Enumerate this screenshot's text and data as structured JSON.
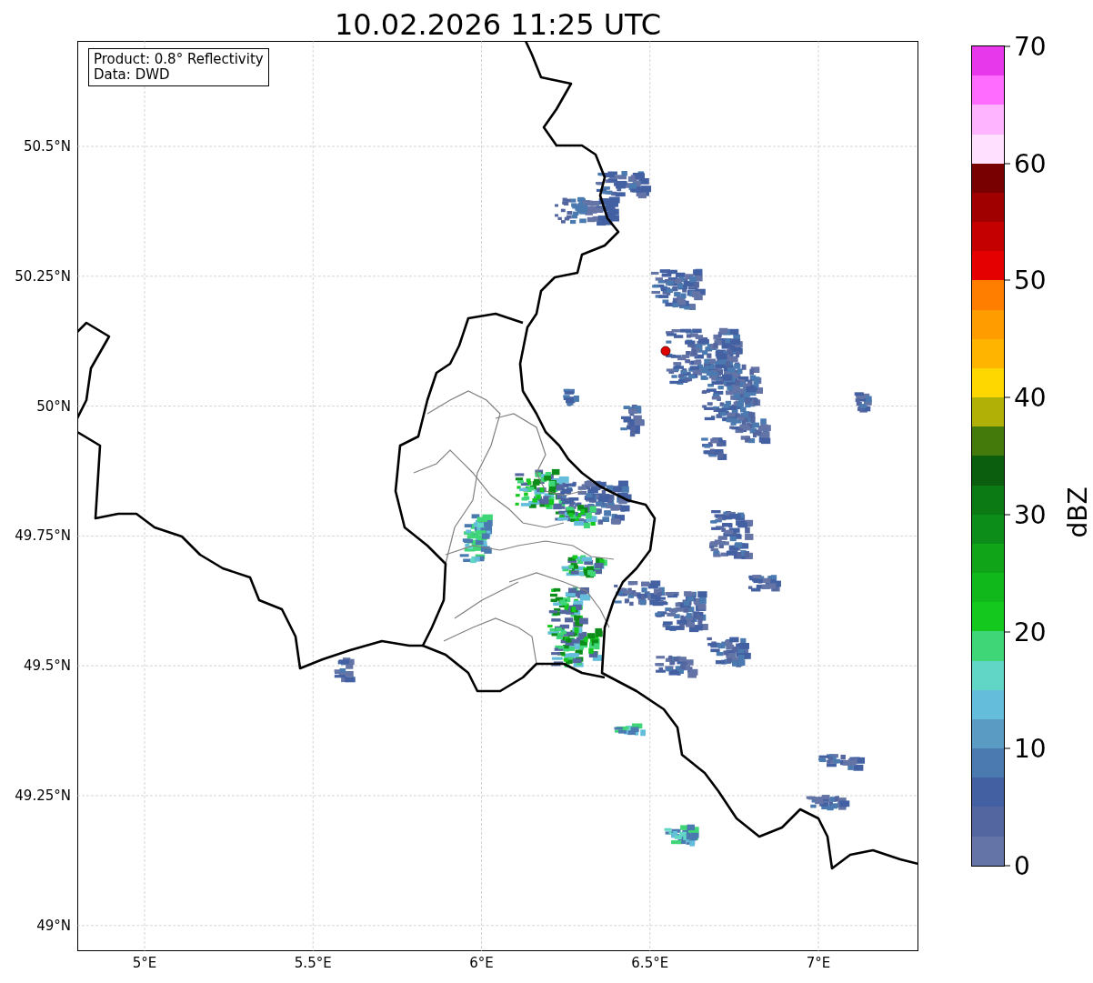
{
  "title": "10.02.2026 11:25 UTC",
  "legend": {
    "lines": [
      "Product: 0.8° Reflectivity",
      "Data: DWD"
    ]
  },
  "map": {
    "y_ticks": [
      "50.5°N",
      "50.25°N",
      "50°N",
      "49.75°N",
      "49.5°N",
      "49.25°N",
      "49°N"
    ],
    "x_ticks": [
      "5°E",
      "5.5°E",
      "6°E",
      "6.5°E",
      "7°E"
    ]
  },
  "colorbar": {
    "label": "dBZ",
    "ticks": [
      "70",
      "60",
      "50",
      "40",
      "30",
      "20",
      "10",
      "0"
    ],
    "segments": [
      {
        "color": "#e838ec"
      },
      {
        "color": "#ff6cff"
      },
      {
        "color": "#ffb4ff"
      },
      {
        "color": "#ffe0ff"
      },
      {
        "color": "#780000"
      },
      {
        "color": "#a00000"
      },
      {
        "color": "#c40000"
      },
      {
        "color": "#e40000"
      },
      {
        "color": "#ff7e00"
      },
      {
        "color": "#ff9c00"
      },
      {
        "color": "#ffb400"
      },
      {
        "color": "#ffd700"
      },
      {
        "color": "#b0b006"
      },
      {
        "color": "#447a0c"
      },
      {
        "color": "#0a5e0e"
      },
      {
        "color": "#0c7a14"
      },
      {
        "color": "#0c8c18"
      },
      {
        "color": "#10a418"
      },
      {
        "color": "#10b81c"
      },
      {
        "color": "#14c81e"
      },
      {
        "color": "#3ed676"
      },
      {
        "color": "#62d6c6"
      },
      {
        "color": "#64bedb"
      },
      {
        "color": "#5a9bc4"
      },
      {
        "color": "#4a7ab0"
      },
      {
        "color": "#4360a2"
      },
      {
        "color": "#5466a0"
      },
      {
        "color": "#6474a6"
      }
    ]
  }
}
